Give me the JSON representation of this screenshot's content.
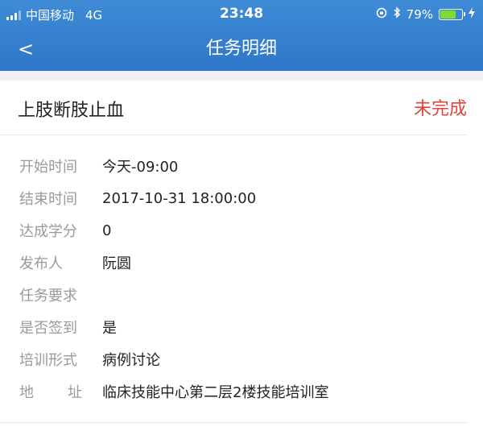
{
  "status_bar": {
    "carrier": "中国移动",
    "network": "4G",
    "time": "23:48",
    "battery_percent": "79%",
    "battery_level": 0.79
  },
  "nav": {
    "back": "<",
    "title": "任务明细"
  },
  "task": {
    "title": "上肢断肢止血",
    "status": "未完成",
    "status_color": "#e4433b"
  },
  "details": [
    {
      "label": "开始时间",
      "value": "今天-09:00"
    },
    {
      "label": "结束时间",
      "value": "2017-10-31 18:00:00"
    },
    {
      "label": "达成学分",
      "value": "0"
    },
    {
      "label": "发布人",
      "value": "阮圆"
    },
    {
      "label": "任务要求",
      "value": ""
    },
    {
      "label": "是否签到",
      "value": "是"
    },
    {
      "label": "培训形式",
      "value": "病例讨论"
    },
    {
      "label_a": "地",
      "label_b": "址",
      "value": "临床技能中心第二层2楼技能培训室"
    }
  ]
}
